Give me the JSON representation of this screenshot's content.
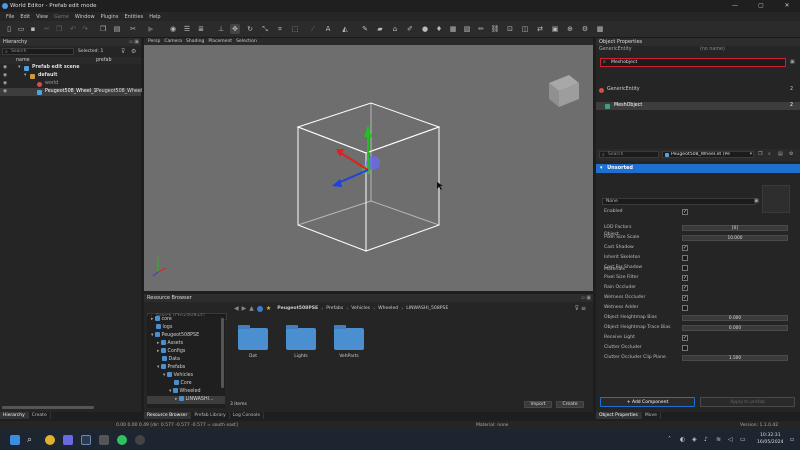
{
  "window": {
    "title": "World Editor - Prefab edit mode",
    "controls": [
      "—",
      "▢",
      "✕"
    ]
  },
  "menu": [
    "File",
    "Edit",
    "View",
    "Game",
    "Window",
    "Plugins",
    "Entities",
    "Help"
  ],
  "viewport_tabs": [
    "Persp",
    "Camera",
    "Shading",
    "Placement",
    "Selection"
  ],
  "hierarchy": {
    "title": "Hierarchy",
    "search_placeholder": "Search",
    "selected_label": "Selected: 1",
    "col_name": "name",
    "col_prefab": "prefab",
    "rows": [
      {
        "label": "Prefab edit scene",
        "prefab": ""
      },
      {
        "label": "default",
        "prefab": ""
      },
      {
        "label": "world",
        "prefab": ""
      },
      {
        "label": "Peugeot508_Wheel_1",
        "prefab": "Peugeot508_Wheel"
      }
    ],
    "tabs": [
      "Hierarchy",
      "Create"
    ]
  },
  "resource_browser": {
    "title": "Resource Browser",
    "search_placeholder": "Search (Ctrl+Shift+F)",
    "breadcrumb": [
      "Peugeot508PSE",
      "Prefabs",
      "Vehicles",
      "Wheeled",
      "LINWASHI_508PSE"
    ],
    "tree": [
      {
        "label": "core",
        "depth": 0
      },
      {
        "label": "logs",
        "depth": 0
      },
      {
        "label": "Peugeot508PSE",
        "depth": 0
      },
      {
        "label": "Assets",
        "depth": 1
      },
      {
        "label": "Configs",
        "depth": 1
      },
      {
        "label": "Data",
        "depth": 1
      },
      {
        "label": "Prefabs",
        "depth": 1
      },
      {
        "label": "Vehicles",
        "depth": 2
      },
      {
        "label": "Core",
        "depth": 3
      },
      {
        "label": "Wheeled",
        "depth": 3
      },
      {
        "label": "LINWASHI...",
        "depth": 4
      }
    ],
    "folders": [
      "Dot",
      "Lights",
      "VehParts"
    ],
    "items_count": "3 items",
    "import_label": "Import",
    "create_label": "Create",
    "tabs": [
      "Resource Browser",
      "Prefab Library",
      "Log Console"
    ]
  },
  "object_properties": {
    "title": "Object Properties",
    "entity_label": "GenericEntity",
    "no_name": "(no name)",
    "search_value": "Meshobject",
    "results": [
      {
        "label": "GenericEntity",
        "count": "2"
      },
      {
        "label": "MeshObject",
        "count": "2"
      }
    ],
    "filter_placeholder": "Search",
    "prefab_name": "Peugeot508_Wheel.et (Pe",
    "prefab_dropdown": "▾",
    "section_title": "Unsorted",
    "enabled_label": "Enabled",
    "object_label": "Object",
    "object_value": "None",
    "materials_label": "Materials",
    "props": [
      {
        "label": "LOD Factors",
        "type": "value",
        "value": "[0]"
      },
      {
        "label": "Pixel Size Scale",
        "type": "value",
        "value": "10.000"
      },
      {
        "label": "Cast Shadow",
        "type": "check",
        "checked": true
      },
      {
        "label": "Inherit Skeleton",
        "type": "check",
        "checked": false
      },
      {
        "label": "Cast Far Shadow",
        "type": "check",
        "checked": false
      },
      {
        "label": "Pixel Size Filter",
        "type": "check",
        "checked": true
      },
      {
        "label": "Rain Occluder",
        "type": "check",
        "checked": true
      },
      {
        "label": "Wetness Occluder",
        "type": "check",
        "checked": true
      },
      {
        "label": "Wetness Adder",
        "type": "check",
        "checked": false
      },
      {
        "label": "Object Heightmap Bias",
        "type": "value",
        "value": "0.000"
      },
      {
        "label": "Object Heightmap Trace Bias",
        "type": "value",
        "value": "0.000"
      },
      {
        "label": "Receive Light",
        "type": "check",
        "checked": true
      },
      {
        "label": "Clutter Occluder",
        "type": "check",
        "checked": false
      },
      {
        "label": "Clutter Occluder Clip Plane",
        "type": "value",
        "value": "1.500"
      }
    ],
    "add_component": "+ Add Component",
    "apply_prefab": "Apply to prefab",
    "tabs": [
      "Object Properties",
      "Move"
    ],
    "version": "Version: 1.1.0.42 (production)"
  },
  "statusbar": {
    "coords": "0.00   0.00   0.49 [dir: 0.577 -0.577 -0.577 = south east]",
    "material": "Material: none"
  },
  "taskbar": {
    "time": "10:32:31",
    "date": "16/05/2024"
  },
  "colors": {
    "accent": "#1e6fd0",
    "highlight": "#d11f2f",
    "viewport": "#6e6e6e"
  }
}
